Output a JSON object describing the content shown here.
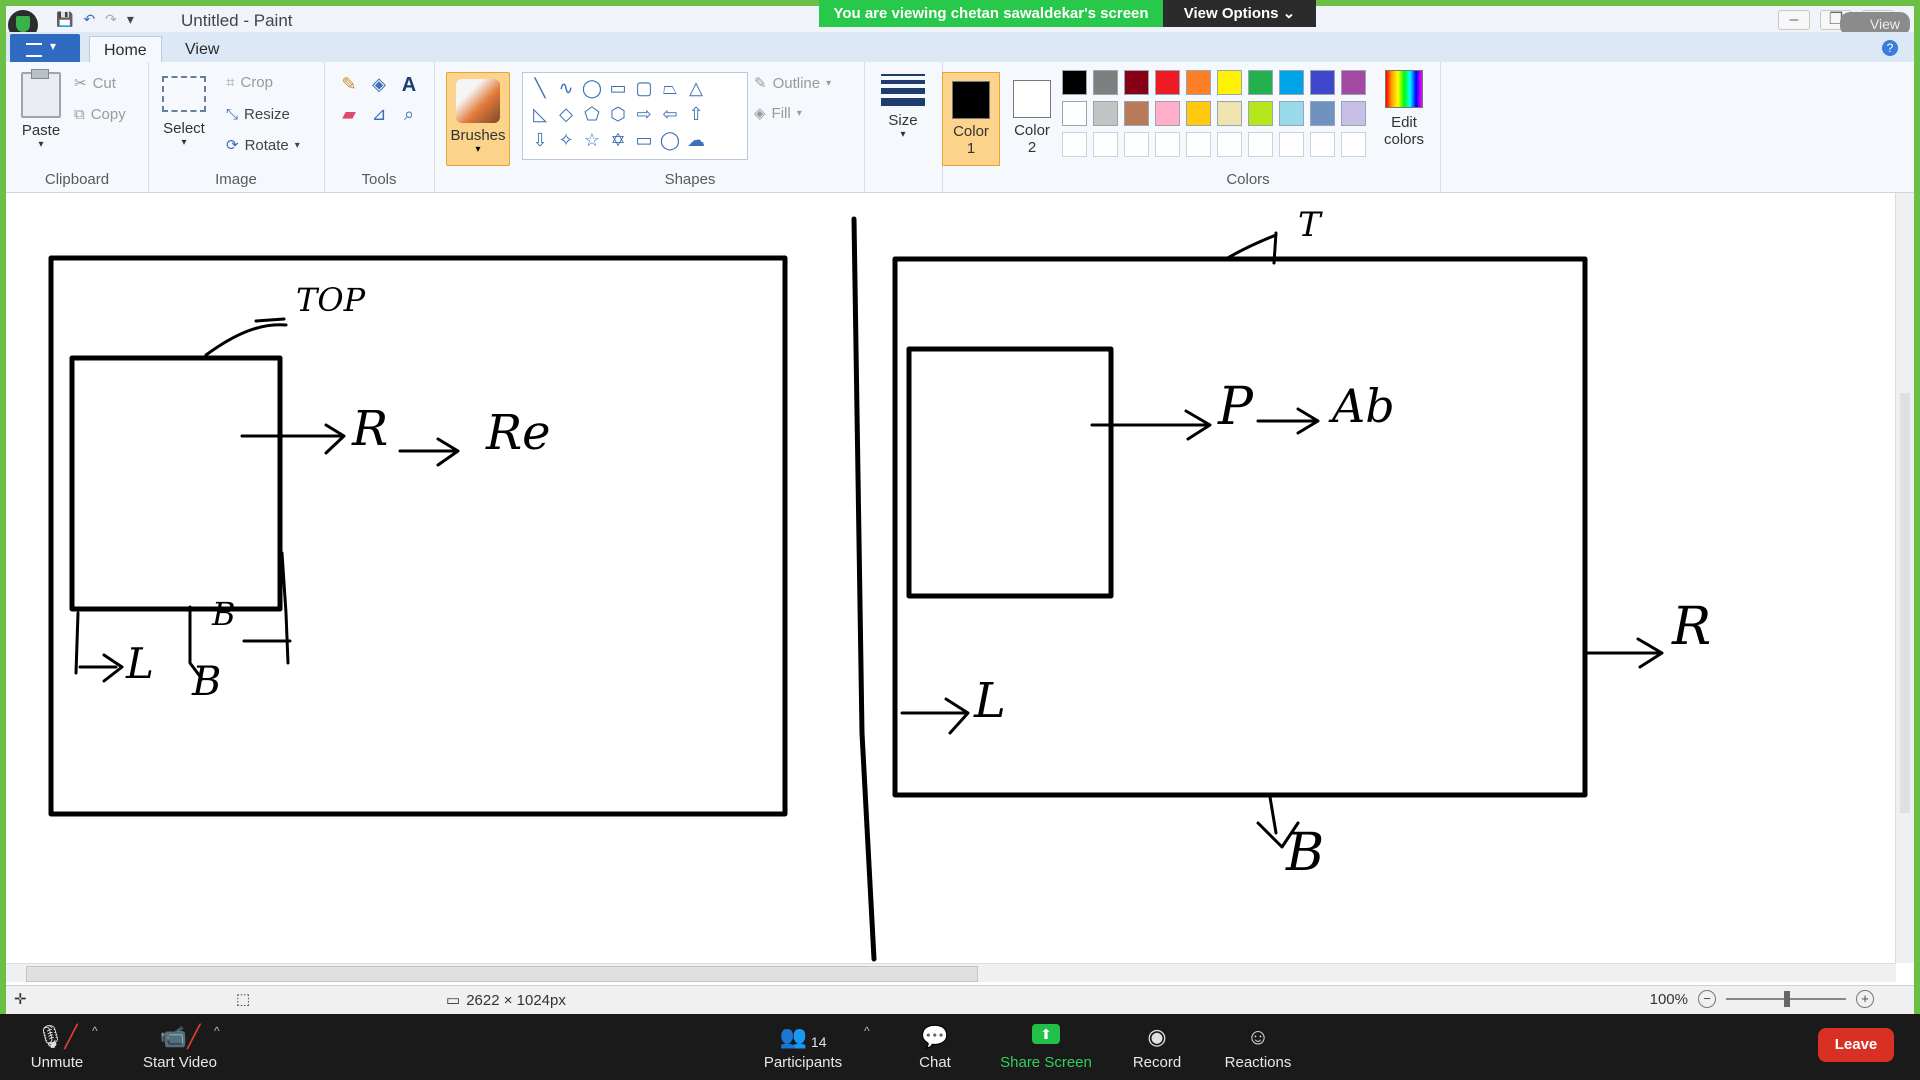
{
  "window": {
    "title": "Untitled - Paint",
    "view_tag": "View"
  },
  "share_banner": {
    "message": "You are viewing chetan sawaldekar's screen",
    "view_options": "View Options ⌄"
  },
  "tabs": [
    {
      "label": "Home"
    },
    {
      "label": "View"
    }
  ],
  "ribbon": {
    "clipboard": {
      "paste": "Paste",
      "cut": "Cut",
      "copy": "Copy",
      "label": "Clipboard"
    },
    "image": {
      "select": "Select",
      "crop": "Crop",
      "resize": "Resize",
      "rotate": "Rotate",
      "label": "Image"
    },
    "tools": {
      "label": "Tools"
    },
    "brushes": {
      "label": "Brushes"
    },
    "shapes": {
      "outline": "Outline",
      "fill": "Fill",
      "label": "Shapes"
    },
    "size": {
      "label": "Size"
    },
    "color1": {
      "label": "Color",
      "num": "1",
      "value": "#000000"
    },
    "color2": {
      "label": "Color",
      "num": "2",
      "value": "#ffffff"
    },
    "colors": {
      "label": "Colors",
      "edit_label": "Edit",
      "edit_label2": "colors"
    },
    "palette": [
      "#000000",
      "#7f7f7f",
      "#880015",
      "#ed1c24",
      "#ff7f27",
      "#fff200",
      "#22b14c",
      "#00a2e8",
      "#3f48cc",
      "#a349a4",
      "#ffffff",
      "#c3c3c3",
      "#b97a57",
      "#ffaec9",
      "#ffc90e",
      "#efe4b0",
      "#b5e61d",
      "#99d9ea",
      "#7092be",
      "#c8bfe7",
      "#ffffff",
      "#ffffff",
      "#ffffff",
      "#ffffff",
      "#ffffff",
      "#ffffff",
      "#ffffff",
      "#ffffff",
      "#ffffff",
      "#ffffff"
    ]
  },
  "canvas": {
    "left_labels": {
      "top": "TOP",
      "right": "R",
      "right2": "Re",
      "left": "L",
      "bottom1": "B",
      "bottom2": "B"
    },
    "right_labels": {
      "top": "T",
      "pos": "P",
      "abs": "Ab",
      "right": "R",
      "left": "L",
      "bottom": "B"
    }
  },
  "statusbar": {
    "dimensions": "2622 × 1024px",
    "zoom": "100%"
  },
  "zoombar": {
    "unmute": "Unmute",
    "start_video": "Start Video",
    "participants": "Participants",
    "participants_count": "14",
    "chat": "Chat",
    "share_screen": "Share Screen",
    "record": "Record",
    "reactions": "Reactions",
    "leave": "Leave"
  }
}
